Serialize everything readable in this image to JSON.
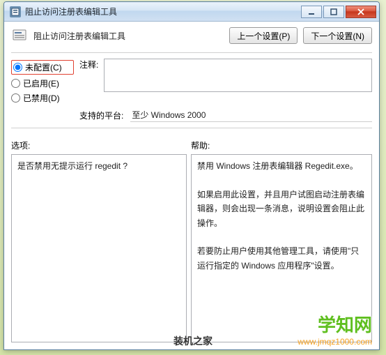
{
  "window": {
    "title": "阻止访问注册表编辑工具"
  },
  "header": {
    "title": "阻止访问注册表编辑工具",
    "prev_button": "上一个设置(P)",
    "next_button": "下一个设置(N)"
  },
  "config": {
    "radio_not_configured": "未配置(C)",
    "radio_enabled": "已启用(E)",
    "radio_disabled": "已禁用(D)",
    "selected": "not_configured",
    "comment_label": "注释:",
    "comment_value": "",
    "platform_label": "支持的平台:",
    "platform_value": "至少 Windows 2000"
  },
  "panes": {
    "options_label": "选项:",
    "help_label": "帮助:",
    "options_text": "是否禁用无提示运行 regedit ?",
    "help_text_1": "禁用 Windows 注册表编辑器 Regedit.exe。",
    "help_text_2": "如果启用此设置，并且用户试图启动注册表编辑器，则会出现一条消息，说明设置会阻止此操作。",
    "help_text_3": "若要防止用户使用其他管理工具，请使用\"只运行指定的 Windows 应用程序\"设置。"
  },
  "branding": {
    "site_name": "学知网",
    "site_url": "www.jmqz1000.com",
    "bottom_label": "装机之家"
  }
}
